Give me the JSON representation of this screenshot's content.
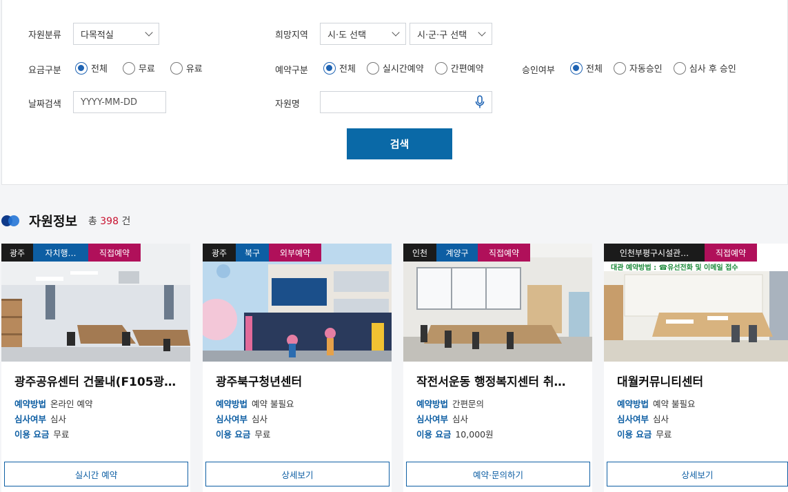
{
  "filters": {
    "resource_category": {
      "label": "자원분류",
      "value": "다목적실"
    },
    "region": {
      "label": "희망지역",
      "sido": "시·도 선택",
      "sigungu": "시·군·구 선택"
    },
    "fee": {
      "label": "요금구분",
      "options": [
        "전체",
        "무료",
        "유료"
      ],
      "selected": "전체"
    },
    "reservation": {
      "label": "예약구분",
      "options": [
        "전체",
        "실시간예약",
        "간편예약"
      ],
      "selected": "전체"
    },
    "approval": {
      "label": "승인여부",
      "options": [
        "전체",
        "자동승인",
        "심사 후 승인"
      ],
      "selected": "전체"
    },
    "date": {
      "label": "날짜검색",
      "placeholder": "YYYY-MM-DD"
    },
    "name": {
      "label": "자원명",
      "placeholder": ""
    },
    "search_label": "검색"
  },
  "results": {
    "title": "자원정보",
    "count_prefix": "총",
    "count": "398",
    "count_suffix": "건"
  },
  "cards": [
    {
      "tags": [
        "광주",
        "자치행…",
        "직접예약"
      ],
      "title": "광주공유센터 건물내(F105광…",
      "method_k": "예약방법",
      "method_v": "온라인 예약",
      "review_k": "심사여부",
      "review_v": "심사",
      "fee_k": "이용 요금",
      "fee_v": "무료",
      "button": "실시간 예약"
    },
    {
      "tags": [
        "광주",
        "북구",
        "외부예약"
      ],
      "title": "광주북구청년센터",
      "method_k": "예약방법",
      "method_v": "예약 불필요",
      "review_k": "심사여부",
      "review_v": "심사",
      "fee_k": "이용 요금",
      "fee_v": "무료",
      "button": "상세보기"
    },
    {
      "tags": [
        "인천",
        "계양구",
        "직접예약"
      ],
      "title": "작전서운동 행정복지센터 취…",
      "method_k": "예약방법",
      "method_v": "간편문의",
      "review_k": "심사여부",
      "review_v": "심사",
      "fee_k": "이용 요금",
      "fee_v": "10,000원",
      "button": "예약·문의하기"
    },
    {
      "tags": [
        "인천부평구시설관…",
        "직접예약"
      ],
      "img_text": "대관 예약방법 : ☎유선전화 및 이메일 접수",
      "title": "대월커뮤니티센터",
      "method_k": "예약방법",
      "method_v": "예약 불필요",
      "review_k": "심사여부",
      "review_v": "심사",
      "fee_k": "이용 요금",
      "fee_v": "무료",
      "button": "상세보기"
    }
  ],
  "colors": {
    "primary": "#0a69a7",
    "accent_tag": "#b0105a",
    "count": "#c8102e"
  }
}
